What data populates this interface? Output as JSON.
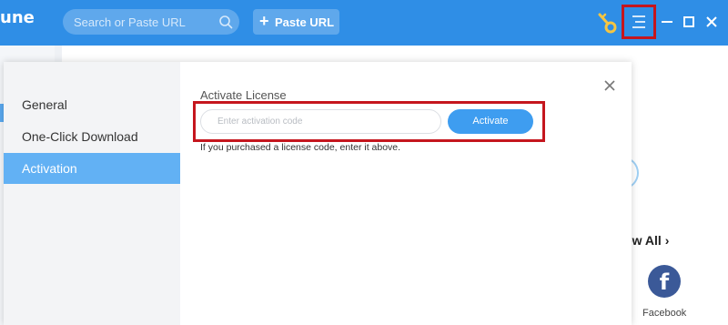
{
  "app": {
    "name": "une"
  },
  "toolbar": {
    "search_placeholder": "Search or Paste URL",
    "paste_label": "Paste URL",
    "paste_icon": "+",
    "icons": [
      "search-icon",
      "key-icon",
      "hamburger-menu-icon",
      "minimize-icon",
      "maximize-icon",
      "close-icon"
    ]
  },
  "background": {
    "view_all": "iew All",
    "view_all_chevron": "›",
    "facebook_glyph": "f",
    "facebook_label": "Facebook"
  },
  "settings": {
    "nav": [
      {
        "label": "General",
        "active": false
      },
      {
        "label": "One-Click Download",
        "active": false
      },
      {
        "label": "Activation",
        "active": true
      }
    ],
    "activation": {
      "title": "Activate License",
      "input_placeholder": "Enter activation code",
      "button_label": "Activate",
      "hint": "If you purchased a license code, enter it above."
    }
  },
  "colors": {
    "topbar": "#2f8ee6",
    "accent": "#62b1f4",
    "highlight_box": "#c5161e",
    "button": "#3e9df0"
  }
}
